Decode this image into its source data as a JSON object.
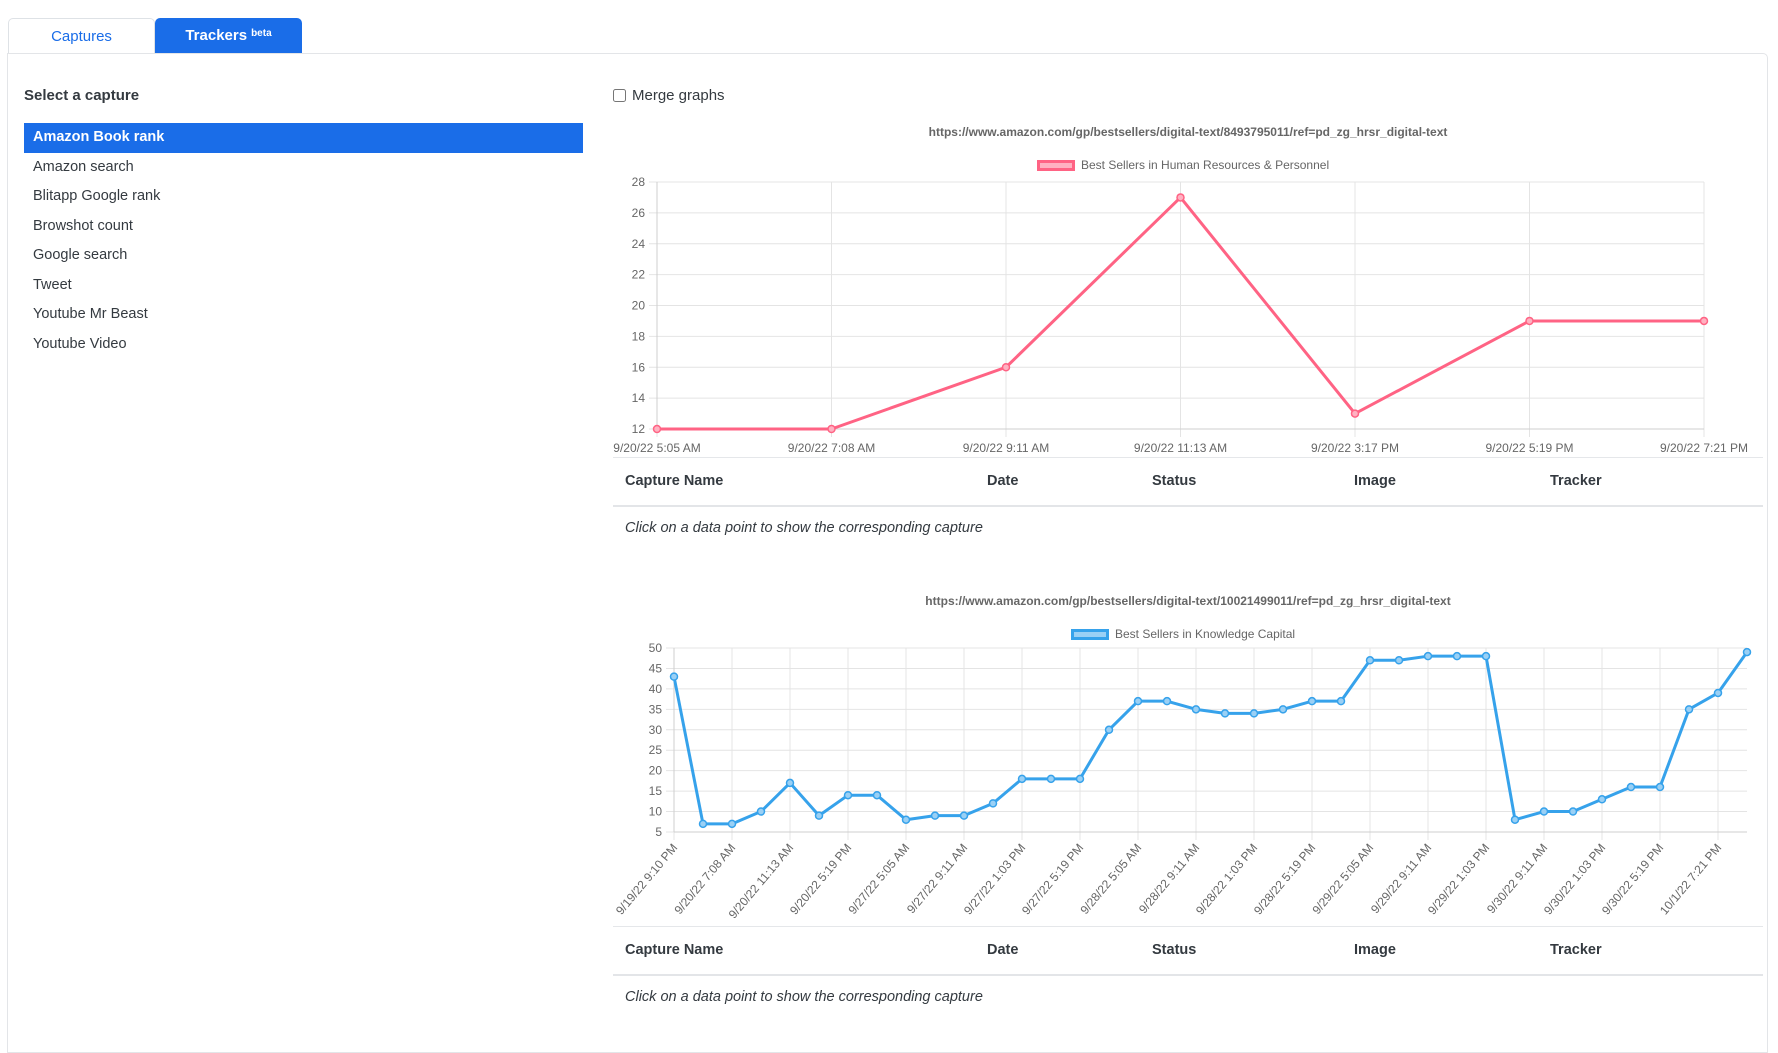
{
  "tabs": [
    {
      "label": "Captures",
      "active": false
    },
    {
      "label": "Trackers",
      "badge": "beta",
      "active": true
    }
  ],
  "sidebar": {
    "title": "Select a capture",
    "items": [
      {
        "label": "Amazon Book rank",
        "active": true
      },
      {
        "label": "Amazon search"
      },
      {
        "label": "Blitapp Google rank"
      },
      {
        "label": "Browshot count"
      },
      {
        "label": "Google search"
      },
      {
        "label": "Tweet"
      },
      {
        "label": "Youtube Mr Beast"
      },
      {
        "label": "Youtube Video"
      }
    ]
  },
  "merge_graphs": {
    "label": "Merge graphs",
    "checked": false
  },
  "table": {
    "headers": [
      "Capture Name",
      "Date",
      "Status",
      "Image",
      "Tracker"
    ],
    "empty_hint": "Click on a data point to show the corresponding capture"
  },
  "chart_data": [
    {
      "type": "line",
      "title": "https://www.amazon.com/gp/bestsellers/digital-text/8493795011/ref=pd_zg_hrsr_digital-text",
      "legend": "top",
      "x": [
        "9/20/22 5:05 AM",
        "9/20/22 7:08 AM",
        "9/20/22 9:11 AM",
        "9/20/22 11:13 AM",
        "9/20/22 3:17 PM",
        "9/20/22 5:19 PM",
        "9/20/22 7:21 PM"
      ],
      "series": [
        {
          "name": "Best Sellers in Human Resources & Personnel",
          "color": "#ff6384",
          "fill": "#ffb1c1",
          "values": [
            12,
            12,
            16,
            27,
            13,
            19,
            19
          ]
        }
      ],
      "ylim": [
        12,
        28
      ],
      "yticks": [
        12,
        14,
        16,
        18,
        20,
        22,
        24,
        26,
        28
      ],
      "xtick_labels": [
        "9/20/22 5:05 AM",
        "9/20/22 7:08 AM",
        "9/20/22 9:11 AM",
        "9/20/22 11:13 AM",
        "9/20/22 3:17 PM",
        "9/20/22 5:19 PM",
        "9/20/22 7:21 PM"
      ],
      "grid": true,
      "xlabel": "",
      "ylabel": ""
    },
    {
      "type": "line",
      "title": "https://www.amazon.com/gp/bestsellers/digital-text/10021499011/ref=pd_zg_hrsr_digital-text",
      "legend": "top",
      "point_count": 38,
      "series": [
        {
          "name": "Best Sellers in Knowledge Capital",
          "color": "#36a2eb",
          "fill": "#9ad0f5",
          "values": [
            43,
            7,
            7,
            10,
            17,
            9,
            14,
            14,
            8,
            9,
            9,
            12,
            18,
            18,
            18,
            30,
            37,
            37,
            35,
            34,
            34,
            35,
            37,
            37,
            47,
            47,
            48,
            48,
            48,
            8,
            10,
            10,
            13,
            16,
            16,
            35,
            39,
            49
          ]
        }
      ],
      "ylim": [
        5,
        50
      ],
      "yticks": [
        5,
        10,
        15,
        20,
        25,
        30,
        35,
        40,
        45,
        50
      ],
      "xtick_labels": [
        "9/19/22 9:10 PM",
        "9/20/22 7:08 AM",
        "9/20/22 11:13 AM",
        "9/20/22 5:19 PM",
        "9/27/22 5:05 AM",
        "9/27/22 9:11 AM",
        "9/27/22 1:03 PM",
        "9/27/22 5:19 PM",
        "9/28/22 5:05 AM",
        "9/28/22 9:11 AM",
        "9/28/22 1:03 PM",
        "9/28/22 5:19 PM",
        "9/29/22 5:05 AM",
        "9/29/22 9:11 AM",
        "9/29/22 1:03 PM",
        "9/30/22 9:11 AM",
        "9/30/22 1:03 PM",
        "9/30/22 5:19 PM",
        "10/1/22 7:21 PM"
      ],
      "xtick_every": 2,
      "grid": true,
      "xlabel": "",
      "ylabel": ""
    }
  ]
}
